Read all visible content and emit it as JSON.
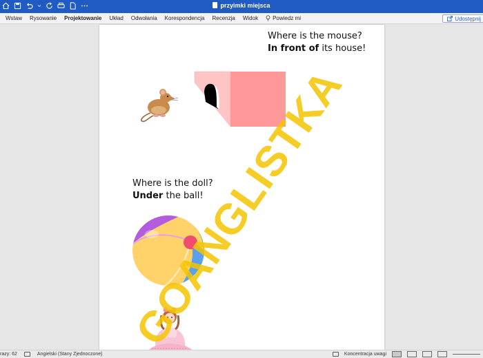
{
  "titlebar": {
    "title": "przyimki miejsca"
  },
  "ribbon": {
    "tabs": [
      "Wstaw",
      "Rysowanie",
      "Projektowanie",
      "Układ",
      "Odwołania",
      "Korespondencja",
      "Recenzja",
      "Widok"
    ],
    "active_tab": "Projektowanie",
    "tell_me": "Powiedz mi",
    "share": "Udostępnij"
  },
  "document": {
    "mouse_question": "Where is the mouse?",
    "mouse_answer_bold": "In front of",
    "mouse_answer_rest": " its house!",
    "doll_question": "Where is the doll?",
    "doll_answer_bold": "Under",
    "doll_answer_rest": " the ball!",
    "watermark_text": "GOANGLISTKA",
    "watermark_color": "#f5c400"
  },
  "statusbar": {
    "words": "razy: 62",
    "language": "Angielski (Stany Zjednoczone)",
    "focus": "Koncentracja uwagi"
  }
}
